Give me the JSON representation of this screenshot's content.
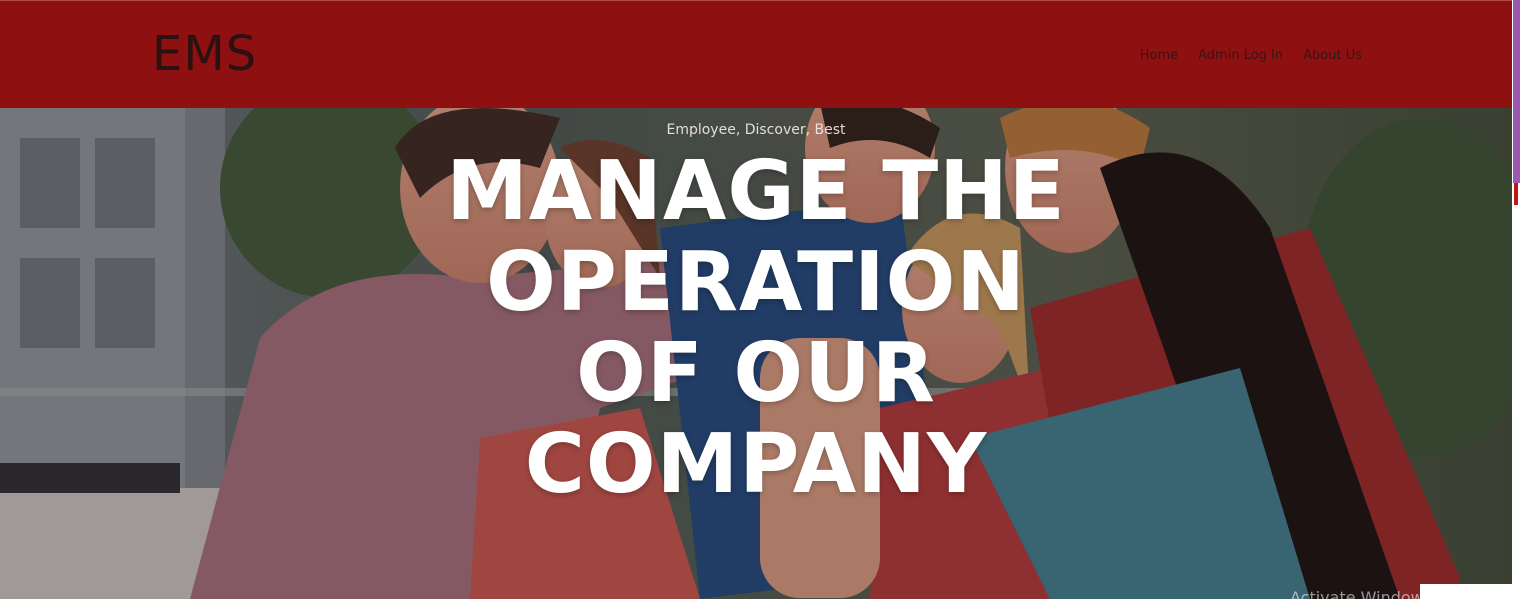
{
  "colors": {
    "navbar_bg": "#8f1010",
    "brand_text": "#2b1111",
    "nav_link": "#3a1414",
    "hero_title": "#ffffff"
  },
  "header": {
    "brand": "EMS",
    "nav": [
      {
        "label": "Home"
      },
      {
        "label": "Admin Log In"
      },
      {
        "label": "About Us"
      }
    ]
  },
  "hero": {
    "kicker": "Employee, Discover, Best",
    "title": "MANAGE THE OPERATION OF OUR COMPANY",
    "image": "team-hands-together-photo"
  },
  "system": {
    "watermark": "Activate Windows"
  }
}
